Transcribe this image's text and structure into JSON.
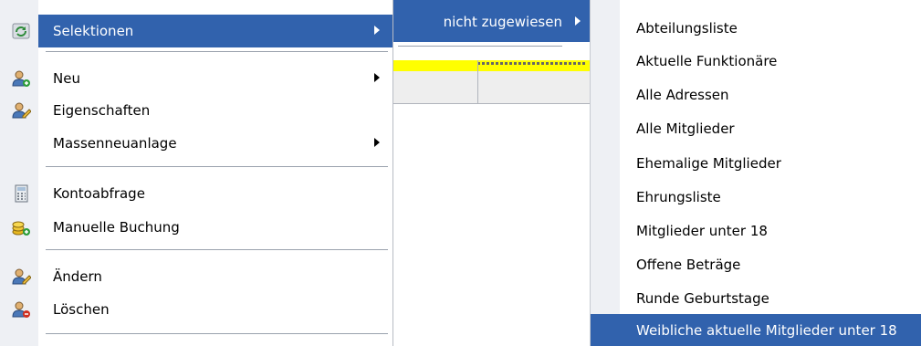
{
  "main_menu": {
    "items": [
      {
        "label": "Selektionen",
        "icon": "refresh-icon",
        "has_submenu": true,
        "highlighted": true
      },
      {
        "label": "Neu",
        "icon": "user-add-icon",
        "has_submenu": true
      },
      {
        "label": "Eigenschaften",
        "icon": "user-edit-icon"
      },
      {
        "label": "Massenneuanlage",
        "has_submenu": true
      },
      {
        "label": "Kontoabfrage",
        "icon": "calculator-icon"
      },
      {
        "label": "Manuelle Buchung",
        "icon": "coins-add-icon"
      },
      {
        "label": "Ändern",
        "icon": "user-edit-icon"
      },
      {
        "label": "Löschen",
        "icon": "user-delete-icon"
      }
    ]
  },
  "submenu_1": {
    "items": [
      {
        "label": "nicht zugewiesen",
        "has_submenu": true,
        "highlighted": true
      }
    ]
  },
  "submenu_2": {
    "items": [
      {
        "label": "Abteilungsliste"
      },
      {
        "label": "Aktuelle Funktionäre"
      },
      {
        "label": "Alle Adressen"
      },
      {
        "label": "Alle Mitglieder"
      },
      {
        "label": "Ehemalige Mitglieder"
      },
      {
        "label": "Ehrungsliste"
      },
      {
        "label": "Mitglieder unter 18"
      },
      {
        "label": "Offene Beträge"
      },
      {
        "label": "Runde Geburtstage"
      },
      {
        "label": "Weibliche aktuelle Mitglieder unter 18",
        "highlighted": true
      }
    ]
  },
  "colors": {
    "highlight": "#3162ad",
    "gutter": "#eef0f4",
    "grid_yellow": "#ffff00"
  }
}
